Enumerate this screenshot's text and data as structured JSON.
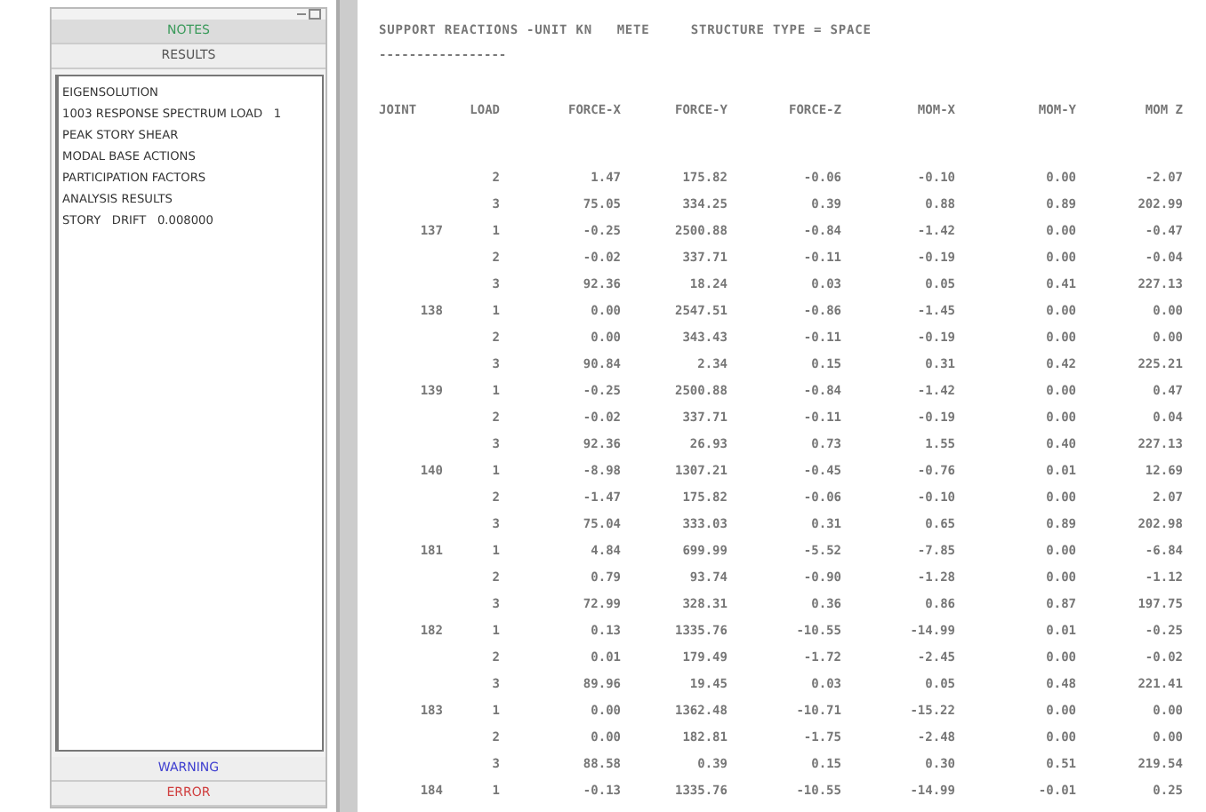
{
  "left_panel": {
    "tabs": [
      {
        "label": "NOTES",
        "kind": "notes"
      },
      {
        "label": "RESULTS",
        "kind": "results"
      }
    ],
    "results_list": [
      "EIGENSOLUTION",
      "1003 RESPONSE SPECTRUM LOAD   1",
      "PEAK STORY SHEAR",
      "MODAL BASE ACTIONS",
      "PARTICIPATION FACTORS",
      "ANALYSIS RESULTS",
      "STORY   DRIFT   0.008000"
    ],
    "bottom_tabs": [
      {
        "label": "WARNING",
        "kind": "warning"
      },
      {
        "label": "ERROR",
        "kind": "error"
      }
    ]
  },
  "report": {
    "title": "SUPPORT REACTIONS -UNIT KN   METE     STRUCTURE TYPE = SPACE",
    "underline": "-----------------",
    "columns": [
      "JOINT",
      "LOAD",
      "FORCE-X",
      "FORCE-Y",
      "FORCE-Z",
      "MOM-X",
      "MOM-Y",
      "MOM Z"
    ],
    "rows": [
      [
        "",
        "2",
        "1.47",
        "175.82",
        "-0.06",
        "-0.10",
        "0.00",
        "-2.07"
      ],
      [
        "",
        "3",
        "75.05",
        "334.25",
        "0.39",
        "0.88",
        "0.89",
        "202.99"
      ],
      [
        "137",
        "1",
        "-0.25",
        "2500.88",
        "-0.84",
        "-1.42",
        "0.00",
        "-0.47"
      ],
      [
        "",
        "2",
        "-0.02",
        "337.71",
        "-0.11",
        "-0.19",
        "0.00",
        "-0.04"
      ],
      [
        "",
        "3",
        "92.36",
        "18.24",
        "0.03",
        "0.05",
        "0.41",
        "227.13"
      ],
      [
        "138",
        "1",
        "0.00",
        "2547.51",
        "-0.86",
        "-1.45",
        "0.00",
        "0.00"
      ],
      [
        "",
        "2",
        "0.00",
        "343.43",
        "-0.11",
        "-0.19",
        "0.00",
        "0.00"
      ],
      [
        "",
        "3",
        "90.84",
        "2.34",
        "0.15",
        "0.31",
        "0.42",
        "225.21"
      ],
      [
        "139",
        "1",
        "-0.25",
        "2500.88",
        "-0.84",
        "-1.42",
        "0.00",
        "0.47"
      ],
      [
        "",
        "2",
        "-0.02",
        "337.71",
        "-0.11",
        "-0.19",
        "0.00",
        "0.04"
      ],
      [
        "",
        "3",
        "92.36",
        "26.93",
        "0.73",
        "1.55",
        "0.40",
        "227.13"
      ],
      [
        "140",
        "1",
        "-8.98",
        "1307.21",
        "-0.45",
        "-0.76",
        "0.01",
        "12.69"
      ],
      [
        "",
        "2",
        "-1.47",
        "175.82",
        "-0.06",
        "-0.10",
        "0.00",
        "2.07"
      ],
      [
        "",
        "3",
        "75.04",
        "333.03",
        "0.31",
        "0.65",
        "0.89",
        "202.98"
      ],
      [
        "181",
        "1",
        "4.84",
        "699.99",
        "-5.52",
        "-7.85",
        "0.00",
        "-6.84"
      ],
      [
        "",
        "2",
        "0.79",
        "93.74",
        "-0.90",
        "-1.28",
        "0.00",
        "-1.12"
      ],
      [
        "",
        "3",
        "72.99",
        "328.31",
        "0.36",
        "0.86",
        "0.87",
        "197.75"
      ],
      [
        "182",
        "1",
        "0.13",
        "1335.76",
        "-10.55",
        "-14.99",
        "0.01",
        "-0.25"
      ],
      [
        "",
        "2",
        "0.01",
        "179.49",
        "-1.72",
        "-2.45",
        "0.00",
        "-0.02"
      ],
      [
        "",
        "3",
        "89.96",
        "19.45",
        "0.03",
        "0.05",
        "0.48",
        "221.41"
      ],
      [
        "183",
        "1",
        "0.00",
        "1362.48",
        "-10.71",
        "-15.22",
        "0.00",
        "0.00"
      ],
      [
        "",
        "2",
        "0.00",
        "182.81",
        "-1.75",
        "-2.48",
        "0.00",
        "0.00"
      ],
      [
        "",
        "3",
        "88.58",
        "0.39",
        "0.15",
        "0.30",
        "0.51",
        "219.54"
      ],
      [
        "184",
        "1",
        "-0.13",
        "1335.76",
        "-10.55",
        "-14.99",
        "-0.01",
        "0.25"
      ]
    ]
  }
}
